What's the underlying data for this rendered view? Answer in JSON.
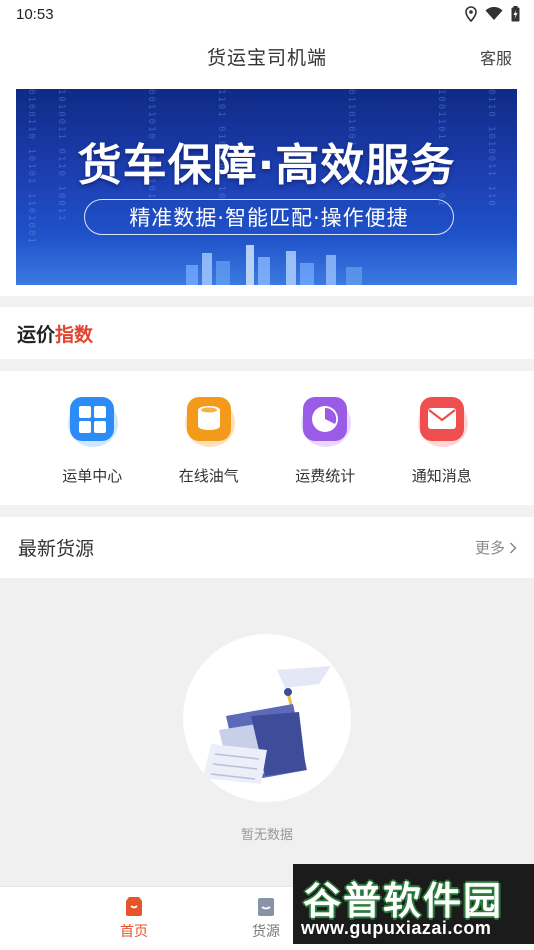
{
  "status_bar": {
    "time": "10:53",
    "icons": [
      "location-icon",
      "wifi-icon",
      "battery-icon"
    ]
  },
  "header": {
    "title": "货运宝司机端",
    "service_label": "客服"
  },
  "banner": {
    "title": "货车保障·高效服务",
    "subtitle": "精准数据·智能匹配·操作便捷"
  },
  "freight_index": {
    "title_prefix": "运价",
    "title_accent": "指数",
    "accent_color": "#e2442f"
  },
  "menu": [
    {
      "label": "运单中心",
      "icon": "grid-icon",
      "color": "#2b8cf5"
    },
    {
      "label": "在线油气",
      "icon": "fuel-tank-icon",
      "color": "#f49a1a"
    },
    {
      "label": "运费统计",
      "icon": "pie-chart-icon",
      "color": "#9a5be6"
    },
    {
      "label": "通知消息",
      "icon": "mail-icon",
      "color": "#ef4e4e"
    }
  ],
  "latest": {
    "title": "最新货源",
    "more_label": "更多"
  },
  "empty_state": {
    "text": "暂无数据"
  },
  "tabbar": {
    "tabs": [
      {
        "label": "首页",
        "icon": "home-bag-icon",
        "active": true
      },
      {
        "label": "货源",
        "icon": "goods-bag-icon",
        "active": false
      }
    ],
    "active_color": "#e8542a"
  },
  "watermark": {
    "main": "谷普软件园",
    "url": "www.gupuxiazai.com"
  }
}
